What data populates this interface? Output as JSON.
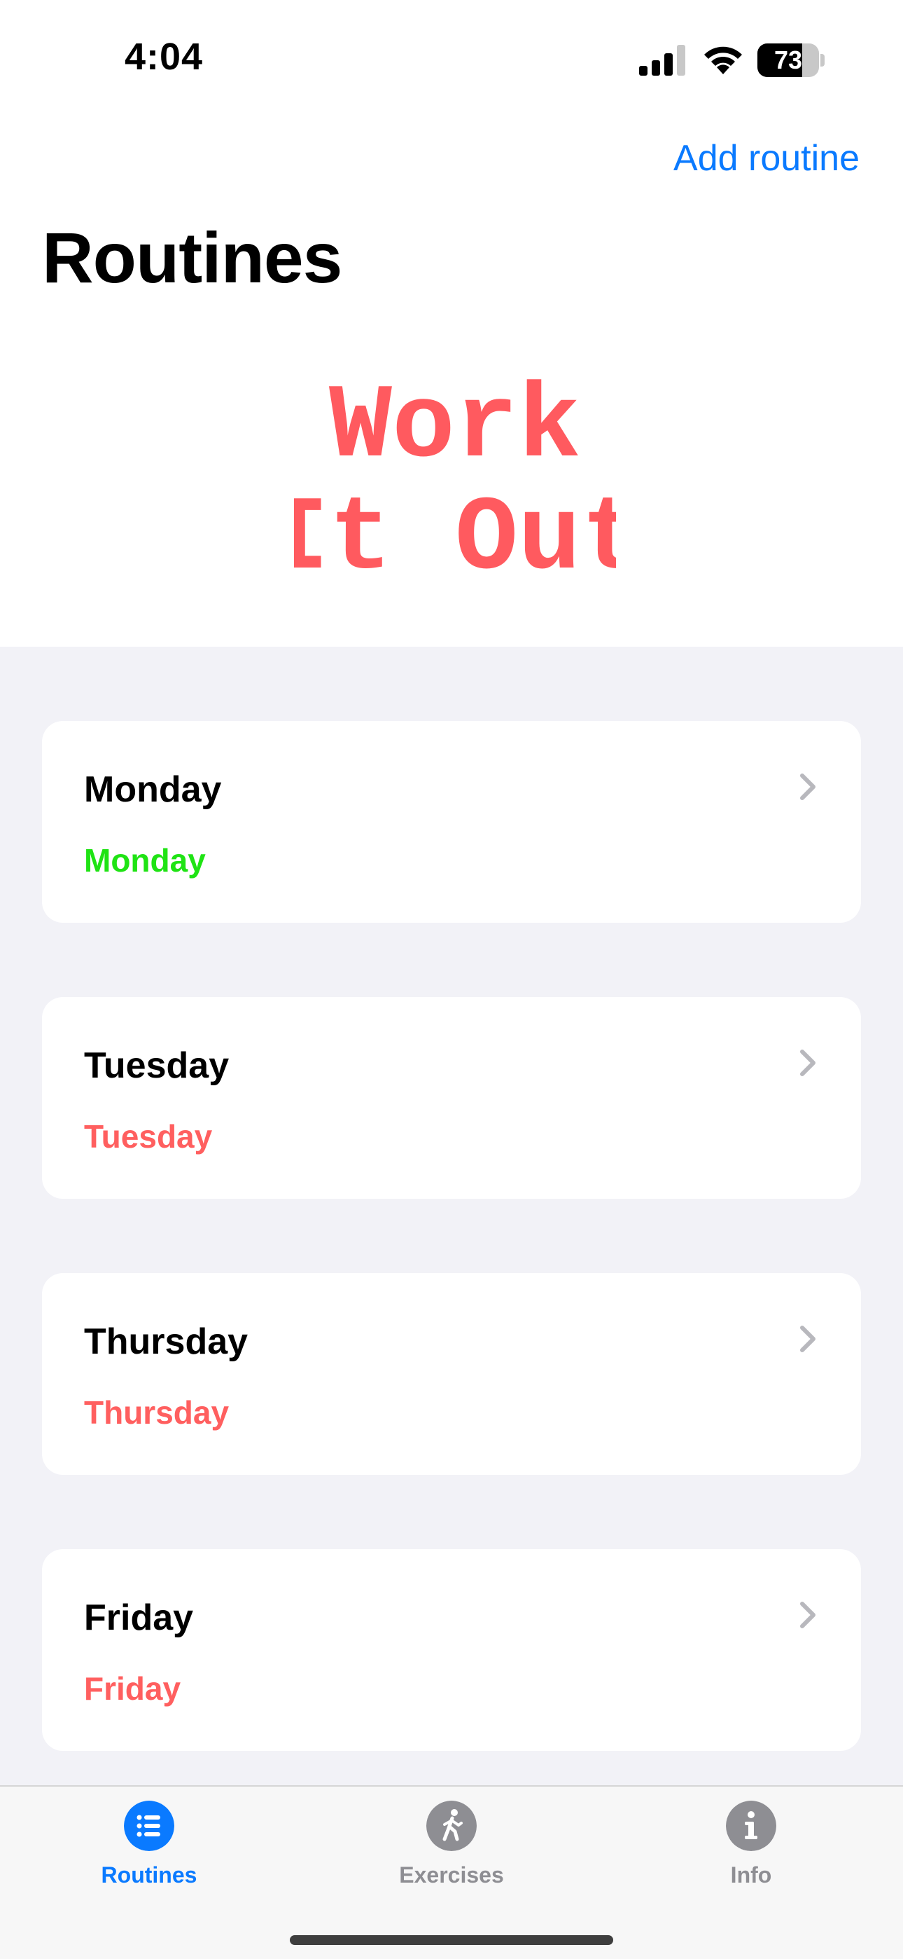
{
  "status_bar": {
    "time": "4:04",
    "battery_level": "73",
    "battery_fraction": 0.73
  },
  "header": {
    "add_routine_label": "Add routine",
    "title": "Routines"
  },
  "logo": {
    "line1": "Work",
    "line2": "It Out",
    "color": "#ff5a5f"
  },
  "routines": [
    {
      "title": "Monday",
      "subtitle": "Monday",
      "subtitle_color": "#1fe314"
    },
    {
      "title": "Tuesday",
      "subtitle": "Tuesday",
      "subtitle_color": "#ff5f5f"
    },
    {
      "title": "Thursday",
      "subtitle": "Thursday",
      "subtitle_color": "#ff5f5f"
    },
    {
      "title": "Friday",
      "subtitle": "Friday",
      "subtitle_color": "#ff5f5f"
    }
  ],
  "tabs": [
    {
      "label": "Routines",
      "icon": "list-icon",
      "active": true
    },
    {
      "label": "Exercises",
      "icon": "walking-icon",
      "active": false
    },
    {
      "label": "Info",
      "icon": "info-icon",
      "active": false
    }
  ],
  "colors": {
    "accent": "#0a7aff",
    "inactive_tab": "#8e8e93",
    "list_background": "#f2f2f7"
  }
}
